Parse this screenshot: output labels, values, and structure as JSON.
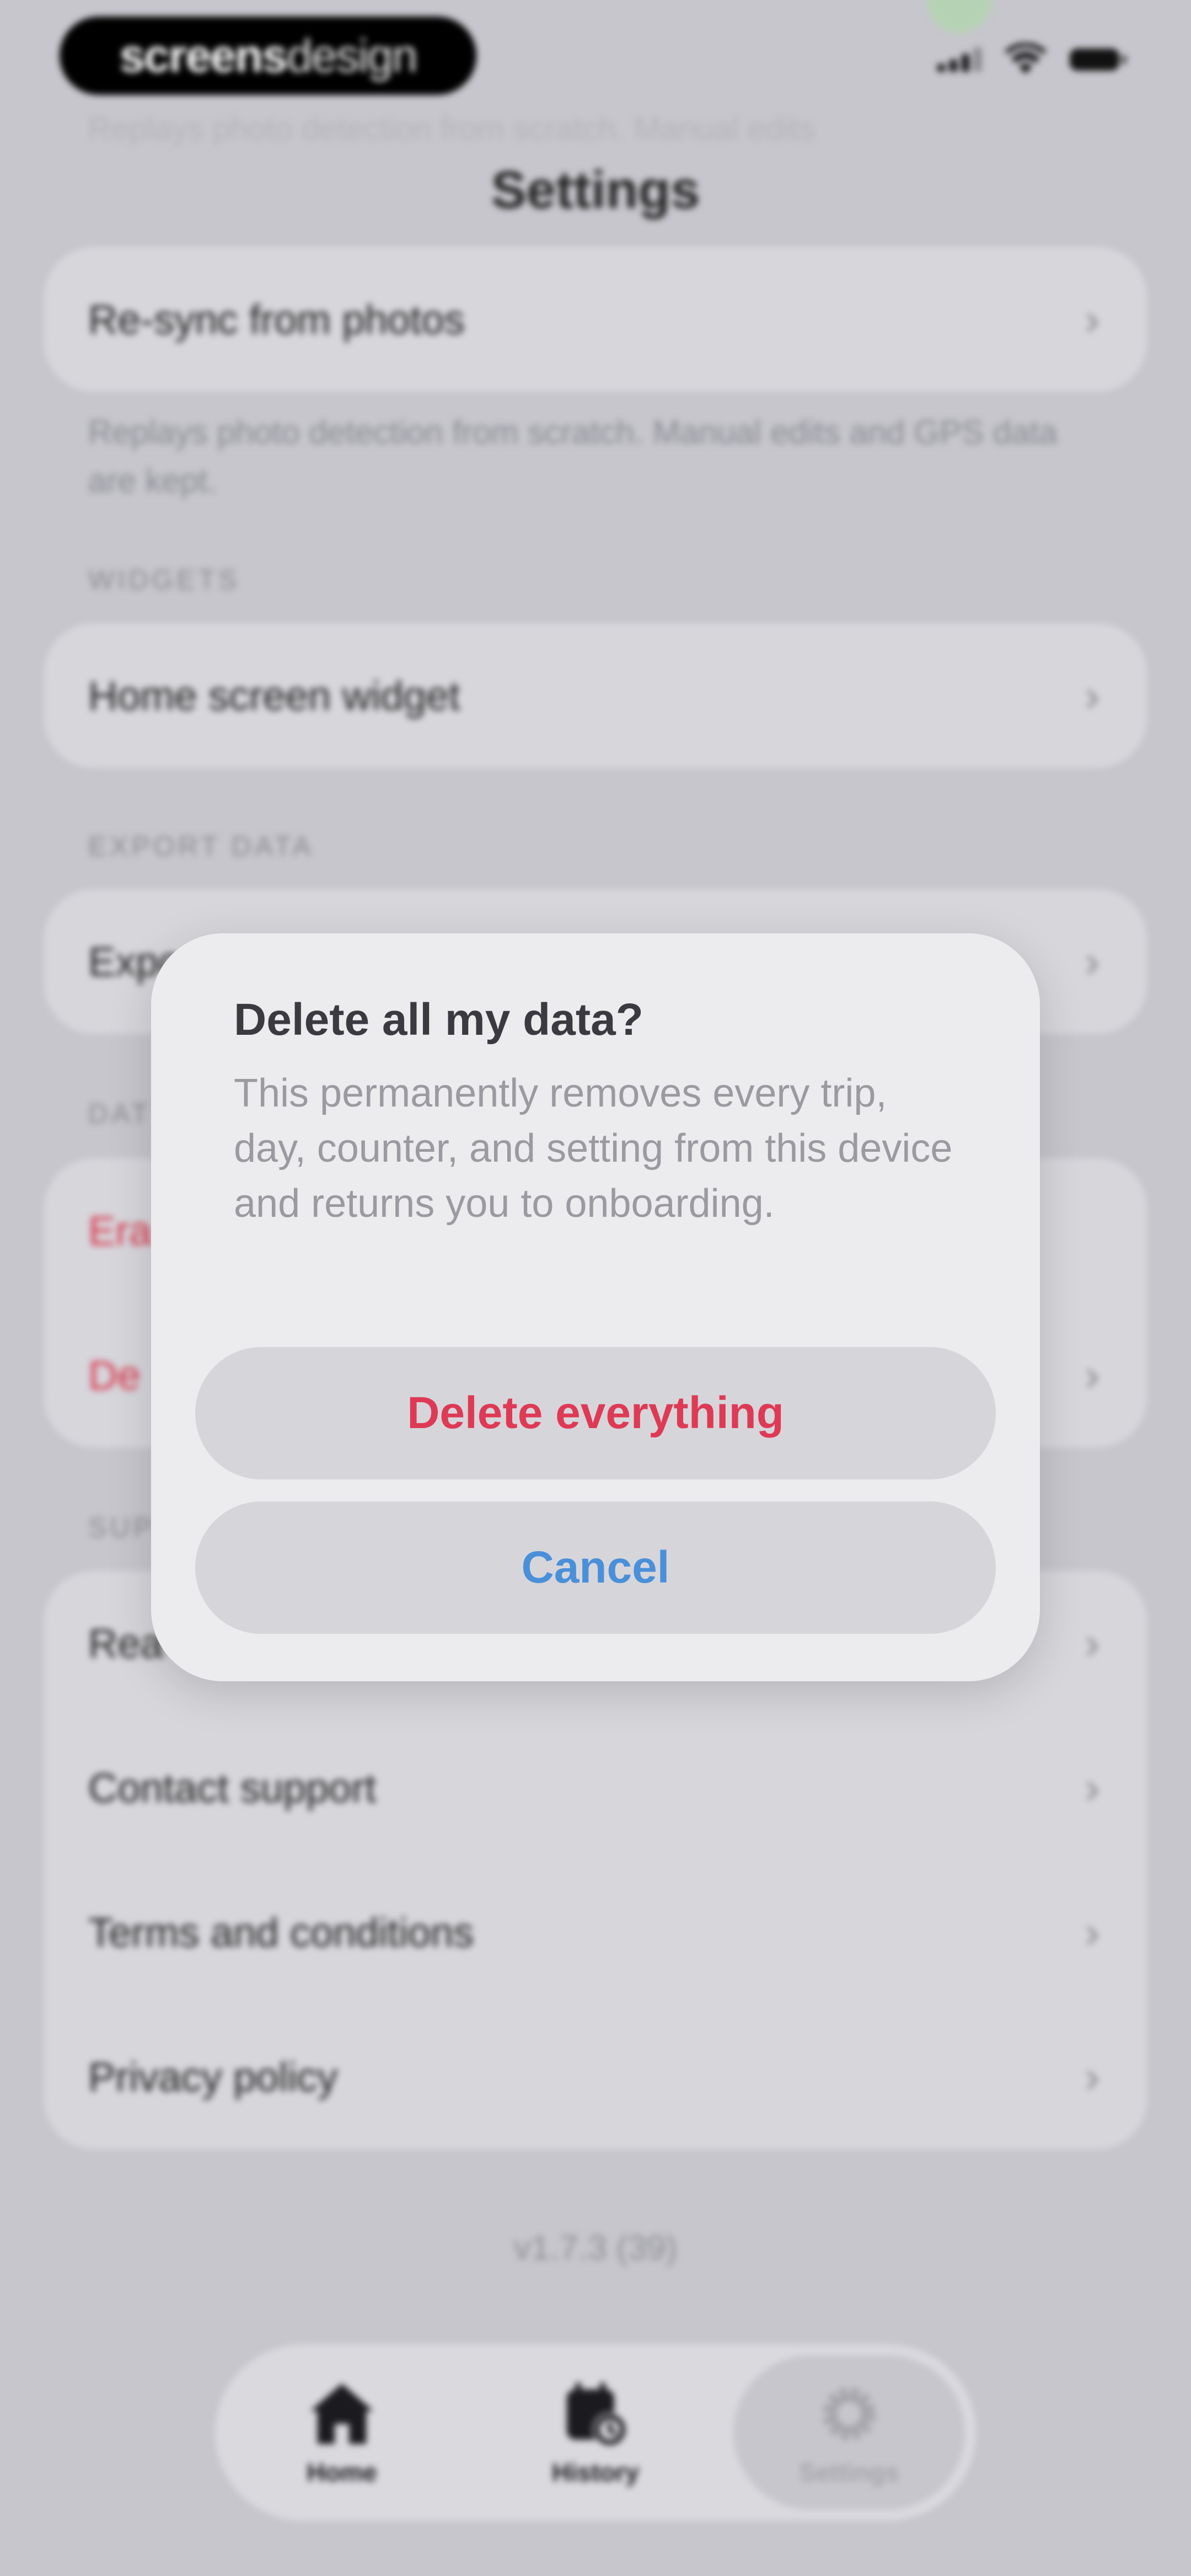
{
  "status_bar": {
    "badge_bold": "screens",
    "badge_light": "design"
  },
  "header": {
    "title": "Settings",
    "faded_text": "Replays photo detection from scratch. Manual edits"
  },
  "sync": {
    "resync_label": "Re-sync from photos",
    "resync_note": "Replays photo detection from scratch. Manual edits and GPS data are kept."
  },
  "widgets": {
    "section_label": "WIDGETS",
    "home_widget_label": "Home screen widget"
  },
  "export": {
    "section_label": "EXPORT DATA",
    "export_label": "Expo"
  },
  "data": {
    "section_label": "DAT",
    "erase_label": "Era",
    "delete_label": "De"
  },
  "support": {
    "section_label": "SUP",
    "items": [
      {
        "label": "Rea"
      },
      {
        "label": "Contact support"
      },
      {
        "label": "Terms and conditions"
      },
      {
        "label": "Privacy policy"
      }
    ]
  },
  "version": "v1.7.3 (39)",
  "tabbar": {
    "tabs": [
      {
        "label": "Home",
        "icon": "home-icon"
      },
      {
        "label": "History",
        "icon": "calendar-clock-icon"
      },
      {
        "label": "Settings",
        "icon": "gear-icon"
      }
    ],
    "active": "Settings"
  },
  "dialog": {
    "title": "Delete all my data?",
    "body": "This permanently removes every trip, day, counter, and setting from this device and returns you to onboarding.",
    "confirm_label": "Delete everything",
    "cancel_label": "Cancel",
    "confirm_color": "#df3a55",
    "cancel_color": "#4a90d9"
  }
}
